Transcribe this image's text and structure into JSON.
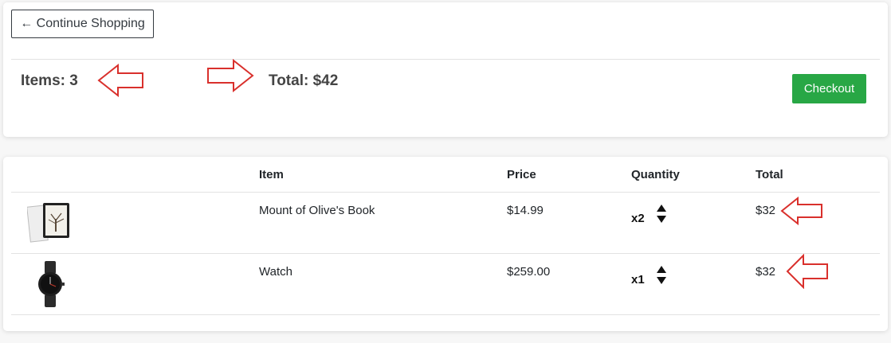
{
  "toolbar": {
    "continue_label": "← Continue Shopping",
    "checkout_label": "Checkout"
  },
  "summary": {
    "items_text": "Items: 3",
    "total_text": "Total: $42"
  },
  "cart": {
    "headers": [
      "",
      "Item",
      "Price",
      "Quantity",
      "Total"
    ],
    "rows": [
      {
        "name": "Mount of Olive's Book",
        "price": "$14.99",
        "quantity": "x2",
        "total": "$32",
        "image_icon": "book-icon"
      },
      {
        "name": "Watch",
        "price": "$259.00",
        "quantity": "x1",
        "total": "$32",
        "image_icon": "watch-icon"
      }
    ]
  },
  "colors": {
    "checkout": "#28a745",
    "annotation_arrow": "#d9302c"
  }
}
